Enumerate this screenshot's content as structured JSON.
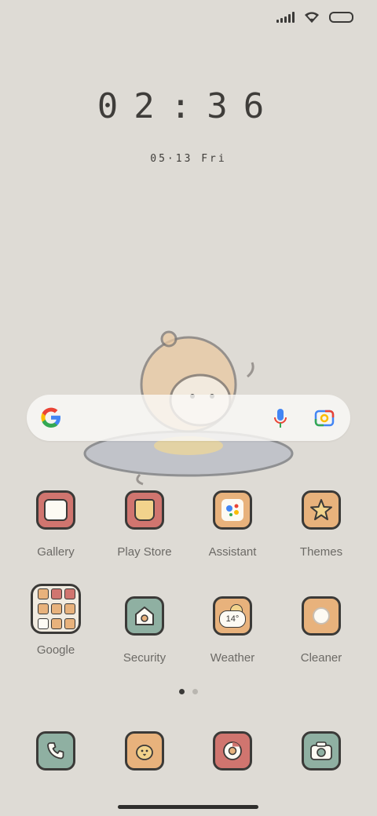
{
  "status_bar": {
    "signal_icon": "signal-bars-icon",
    "wifi_icon": "wifi-icon",
    "battery_icon": "battery-icon"
  },
  "clock": {
    "time": "02:36",
    "date": "05·13 Fri"
  },
  "search_widget": {
    "logo_icon": "google-g-icon",
    "mic_icon": "microphone-icon",
    "lens_icon": "google-lens-icon"
  },
  "apps": [
    {
      "label": "Gallery",
      "icon": "gallery-icon",
      "color": "#d0756f"
    },
    {
      "label": "Play Store",
      "icon": "play-store-icon",
      "color": "#d0756f"
    },
    {
      "label": "Assistant",
      "icon": "assistant-icon",
      "color": "#e8b27c"
    },
    {
      "label": "Themes",
      "icon": "themes-star-icon",
      "color": "#e8b27c"
    },
    {
      "label": "Google",
      "icon": "google-folder-icon",
      "color": "#f1ebe0"
    },
    {
      "label": "Security",
      "icon": "security-icon",
      "color": "#8fb0a2"
    },
    {
      "label": "Weather",
      "icon": "weather-icon",
      "color": "#e8b27c",
      "temp": "14°"
    },
    {
      "label": "Cleaner",
      "icon": "cleaner-icon",
      "color": "#e8b27c"
    }
  ],
  "dock": [
    {
      "icon": "phone-icon",
      "color": "#8fb0a2"
    },
    {
      "icon": "messages-chick-icon",
      "color": "#e8b27c"
    },
    {
      "icon": "browser-icon",
      "color": "#d0756f"
    },
    {
      "icon": "camera-icon",
      "color": "#8fb0a2"
    }
  ],
  "page_indicator": {
    "pages": 2,
    "active": 1
  }
}
